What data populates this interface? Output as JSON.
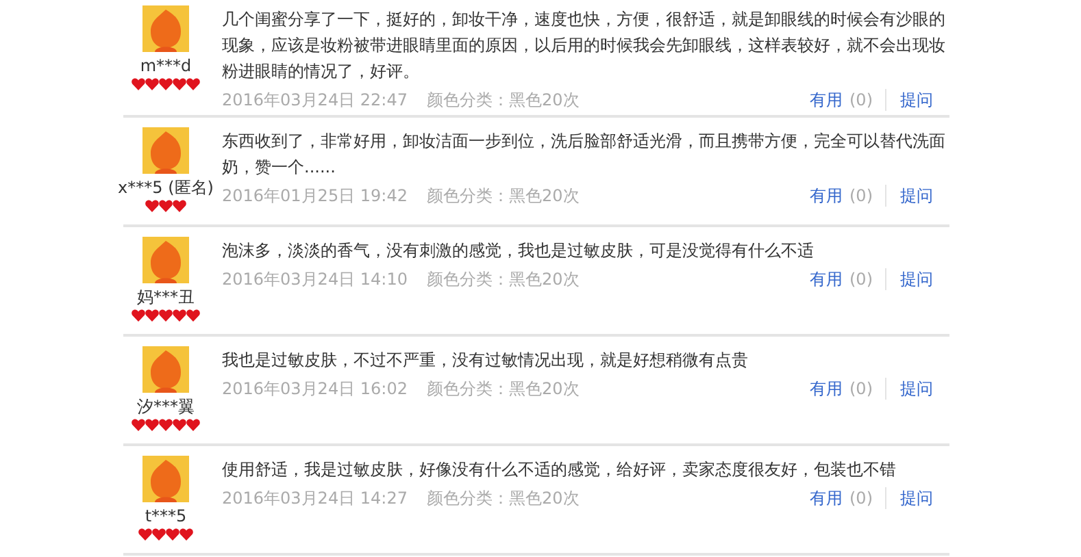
{
  "reviews": [
    {
      "user": "m***d",
      "stars": 5,
      "text": "几个闺蜜分享了一下，挺好的，卸妆干净，速度也快，方便，很舒适，就是卸眼线的时候会有沙眼的现象，应该是妆粉被带进眼睛里面的原因，以后用的时候我会先卸眼线，这样表较好，就不会出现妆粉进眼睛的情况了，好评。",
      "date": "2016年03月24日 22:47",
      "variant": "颜色分类：黑色20次",
      "useful": "有用",
      "useful_count": "(0)",
      "ask": "提问"
    },
    {
      "user": "x***5 (匿名)",
      "stars": 3,
      "text": "东西收到了，非常好用，卸妆洁面一步到位，洗后脸部舒适光滑，而且携带方便，完全可以替代洗面奶，赞一个......",
      "date": "2016年01月25日 19:42",
      "variant": "颜色分类：黑色20次",
      "useful": "有用",
      "useful_count": "(0)",
      "ask": "提问"
    },
    {
      "user": "妈***丑",
      "stars": 5,
      "text": "泡沫多，淡淡的香气，没有刺激的感觉，我也是过敏皮肤，可是没觉得有什么不适",
      "date": "2016年03月24日 14:10",
      "variant": "颜色分类：黑色20次",
      "useful": "有用",
      "useful_count": "(0)",
      "ask": "提问"
    },
    {
      "user": "汐***翼",
      "stars": 5,
      "text": "我也是过敏皮肤，不过不严重，没有过敏情况出现，就是好想稍微有点贵",
      "date": "2016年03月24日 16:02",
      "variant": "颜色分类：黑色20次",
      "useful": "有用",
      "useful_count": "(0)",
      "ask": "提问"
    },
    {
      "user": "t***5",
      "stars": 4,
      "text": "使用舒适，我是过敏皮肤，好像没有什么不适的感觉，给好评，卖家态度很友好，包装也不错",
      "date": "2016年03月24日 14:27",
      "variant": "颜色分类：黑色20次",
      "useful": "有用",
      "useful_count": "(0)",
      "ask": "提问"
    }
  ]
}
